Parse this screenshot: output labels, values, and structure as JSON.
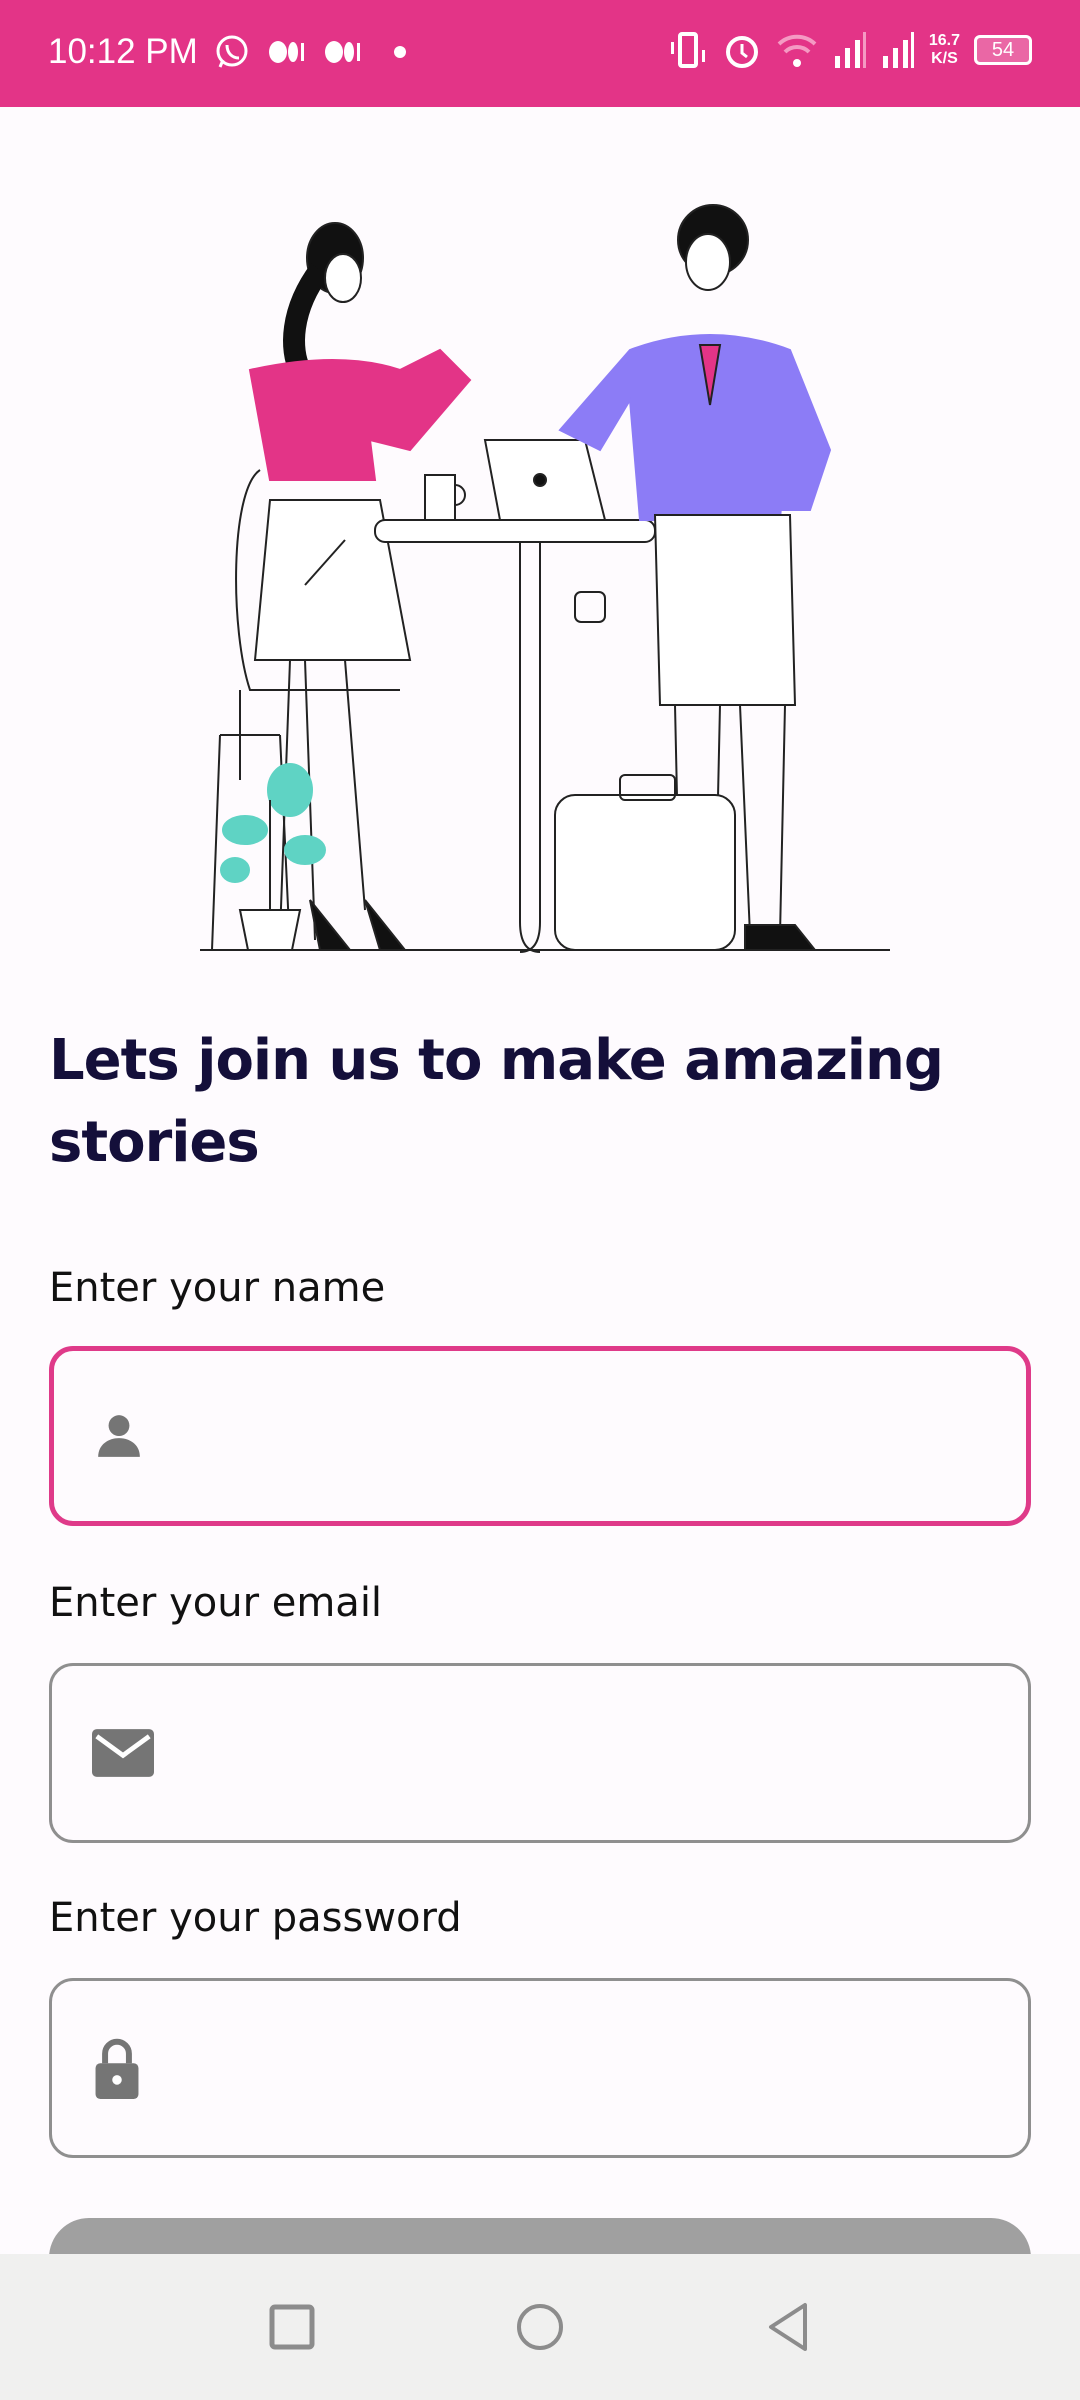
{
  "status_bar": {
    "time": "10:12 PM",
    "net_speed_value": "16.7",
    "net_speed_unit": "K/S",
    "battery": "54"
  },
  "title": "Lets join us to make amazing stories",
  "form": {
    "name_label": "Enter your name",
    "name_value": "",
    "name_icon": "person-icon",
    "email_label": "Enter your email",
    "email_value": "",
    "email_icon": "mail-icon",
    "password_label": "Enter your password",
    "password_value": "",
    "password_icon": "lock-icon"
  },
  "colors": {
    "accent": "#e33487",
    "title": "#140f3a",
    "button": "#a0a0a0"
  }
}
